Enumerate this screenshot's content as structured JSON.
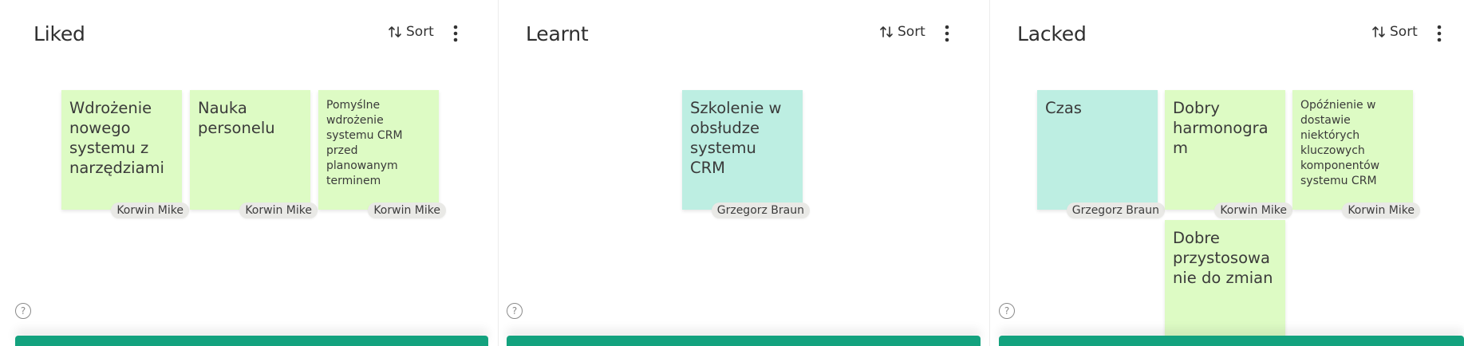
{
  "columns": [
    {
      "title": "Liked",
      "sort_label": "Sort",
      "notes": [
        {
          "text": "Wdrożenie nowego systemu z narzędziami",
          "author": "Korwin Mike"
        },
        {
          "text": "Nauka personelu",
          "author": "Korwin Mike"
        },
        {
          "text": "Pomyślne wdrożenie systemu CRM przed planowanym terminem",
          "author": "Korwin Mike"
        }
      ]
    },
    {
      "title": "Learnt",
      "sort_label": "Sort",
      "notes": [
        {
          "text": "Szkolenie w obsłudze systemu CRM",
          "author": "Grzegorz Braun"
        }
      ]
    },
    {
      "title": "Lacked",
      "sort_label": "Sort",
      "notes": [
        {
          "text": "Czas",
          "author": "Grzegorz Braun"
        },
        {
          "text": "Dobry harmonogram",
          "author": "Korwin Mike"
        },
        {
          "text": "Opóźnienie w dostawie niektórych kluczowych komponentów systemu CRM",
          "author": "Korwin Mike"
        },
        {
          "text": "Dobre przystosowanie do zmian",
          "author": ""
        }
      ]
    }
  ],
  "help_icon_glyph": "?",
  "colors": {
    "note_green": "#ddfbc4",
    "note_teal": "#bdeee2",
    "add_bar": "#13a27e"
  }
}
